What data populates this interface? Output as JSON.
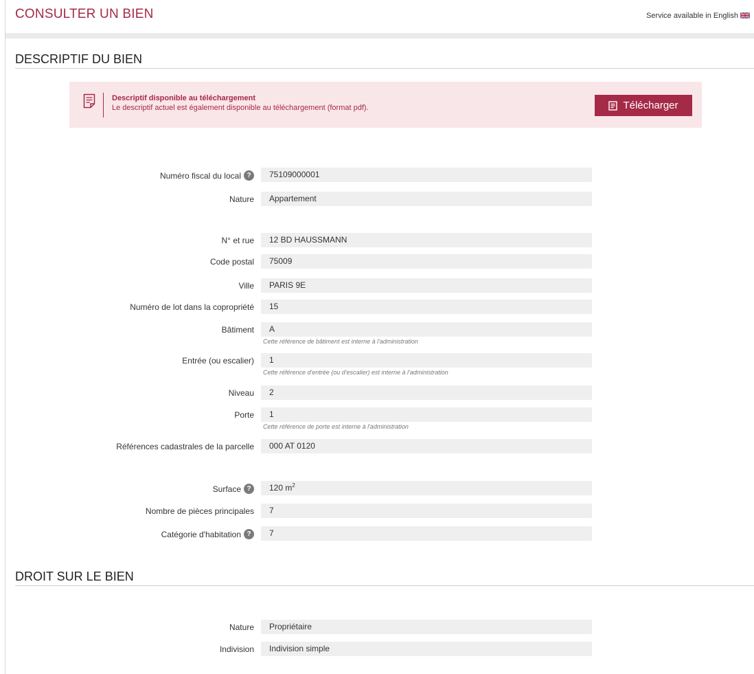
{
  "header": {
    "title": "CONSULTER UN BIEN",
    "language_link": "Service available in English"
  },
  "descriptif": {
    "section_title": "DESCRIPTIF DU BIEN",
    "notice": {
      "title": "Descriptif disponible au téléchargement",
      "text": "Le descriptif actuel est également disponible au téléchargement (format pdf).",
      "download_label": "Télécharger"
    },
    "fields": {
      "numero_fiscal": {
        "label": "Numéro fiscal du local",
        "value": "75109000001",
        "has_help": true
      },
      "nature": {
        "label": "Nature",
        "value": "Appartement"
      },
      "rue": {
        "label": "N° et rue",
        "value": "12 BD HAUSSMANN"
      },
      "code_postal": {
        "label": "Code postal",
        "value": "75009"
      },
      "ville": {
        "label": "Ville",
        "value": "PARIS 9E"
      },
      "lot": {
        "label": "Numéro de lot dans la copropriété",
        "value": "15"
      },
      "batiment": {
        "label": "Bâtiment",
        "value": "A",
        "hint": "Cette référence de bâtiment est interne à l'administration"
      },
      "entree": {
        "label": "Entrée (ou escalier)",
        "value": "1",
        "hint": "Cette référence d'entrée (ou d'escalier) est interne à l'administration"
      },
      "niveau": {
        "label": "Niveau",
        "value": "2"
      },
      "porte": {
        "label": "Porte",
        "value": "1",
        "hint": "Cette référence de porte est interne à l'administration"
      },
      "cadastre": {
        "label": "Références cadastrales de la parcelle",
        "value": "000 AT 0120"
      },
      "surface": {
        "label": "Surface",
        "value": "120 m",
        "unit_exponent": "2",
        "has_help": true
      },
      "pieces": {
        "label": "Nombre de pièces principales",
        "value": "7"
      },
      "categorie": {
        "label": "Catégorie d'habitation",
        "value": "7",
        "has_help": true
      }
    }
  },
  "droit": {
    "section_title": "DROIT SUR LE BIEN",
    "fields": {
      "nature": {
        "label": "Nature",
        "value": "Propriétaire"
      },
      "indivision": {
        "label": "Indivision",
        "value": "Indivision simple"
      }
    }
  },
  "help_glyph": "?",
  "colors": {
    "accent": "#a52a48",
    "notice_bg": "#f9e6e9",
    "value_bg": "#efefef"
  }
}
